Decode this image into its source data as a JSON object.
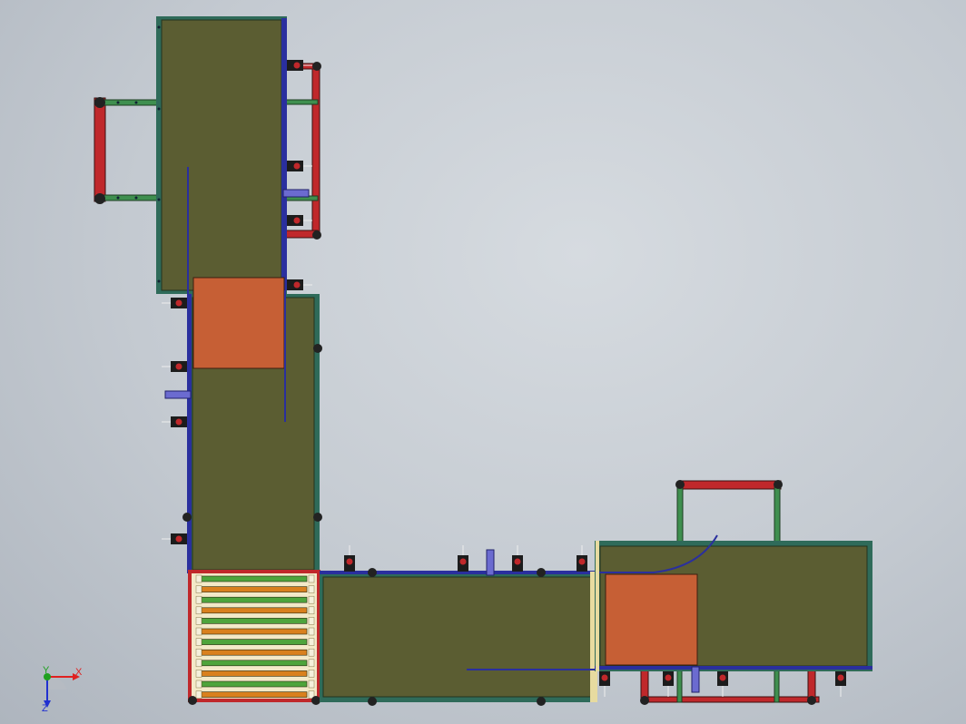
{
  "viewport": {
    "background_colors": [
      "#d6dbe0",
      "#aeb5be"
    ]
  },
  "model": {
    "colors": {
      "deck": "#5b5d32",
      "deck_edge": "#2f6b5a",
      "frame_green": "#3f8f4f",
      "frame_red": "#c0282b",
      "orange_pad": "#c65f35",
      "roller_orange": "#d9801e",
      "roller_green": "#4ea43c",
      "blue_rail": "#2a2f9e",
      "purple_block": "#6b6bd0"
    },
    "parts": {
      "conveyor_top": "vertical-conveyor-upper",
      "conveyor_middle": "vertical-conveyor-lower",
      "roller_table": "corner-roller-table",
      "conveyor_bottom": "horizontal-conveyor",
      "conveyor_right": "transfer-conveyor"
    }
  },
  "triad": {
    "x_label": "X",
    "y_label": "Y",
    "z_label": "Z",
    "colors": {
      "x": "#e02020",
      "y": "#1fa01f",
      "z": "#2030d0"
    }
  }
}
